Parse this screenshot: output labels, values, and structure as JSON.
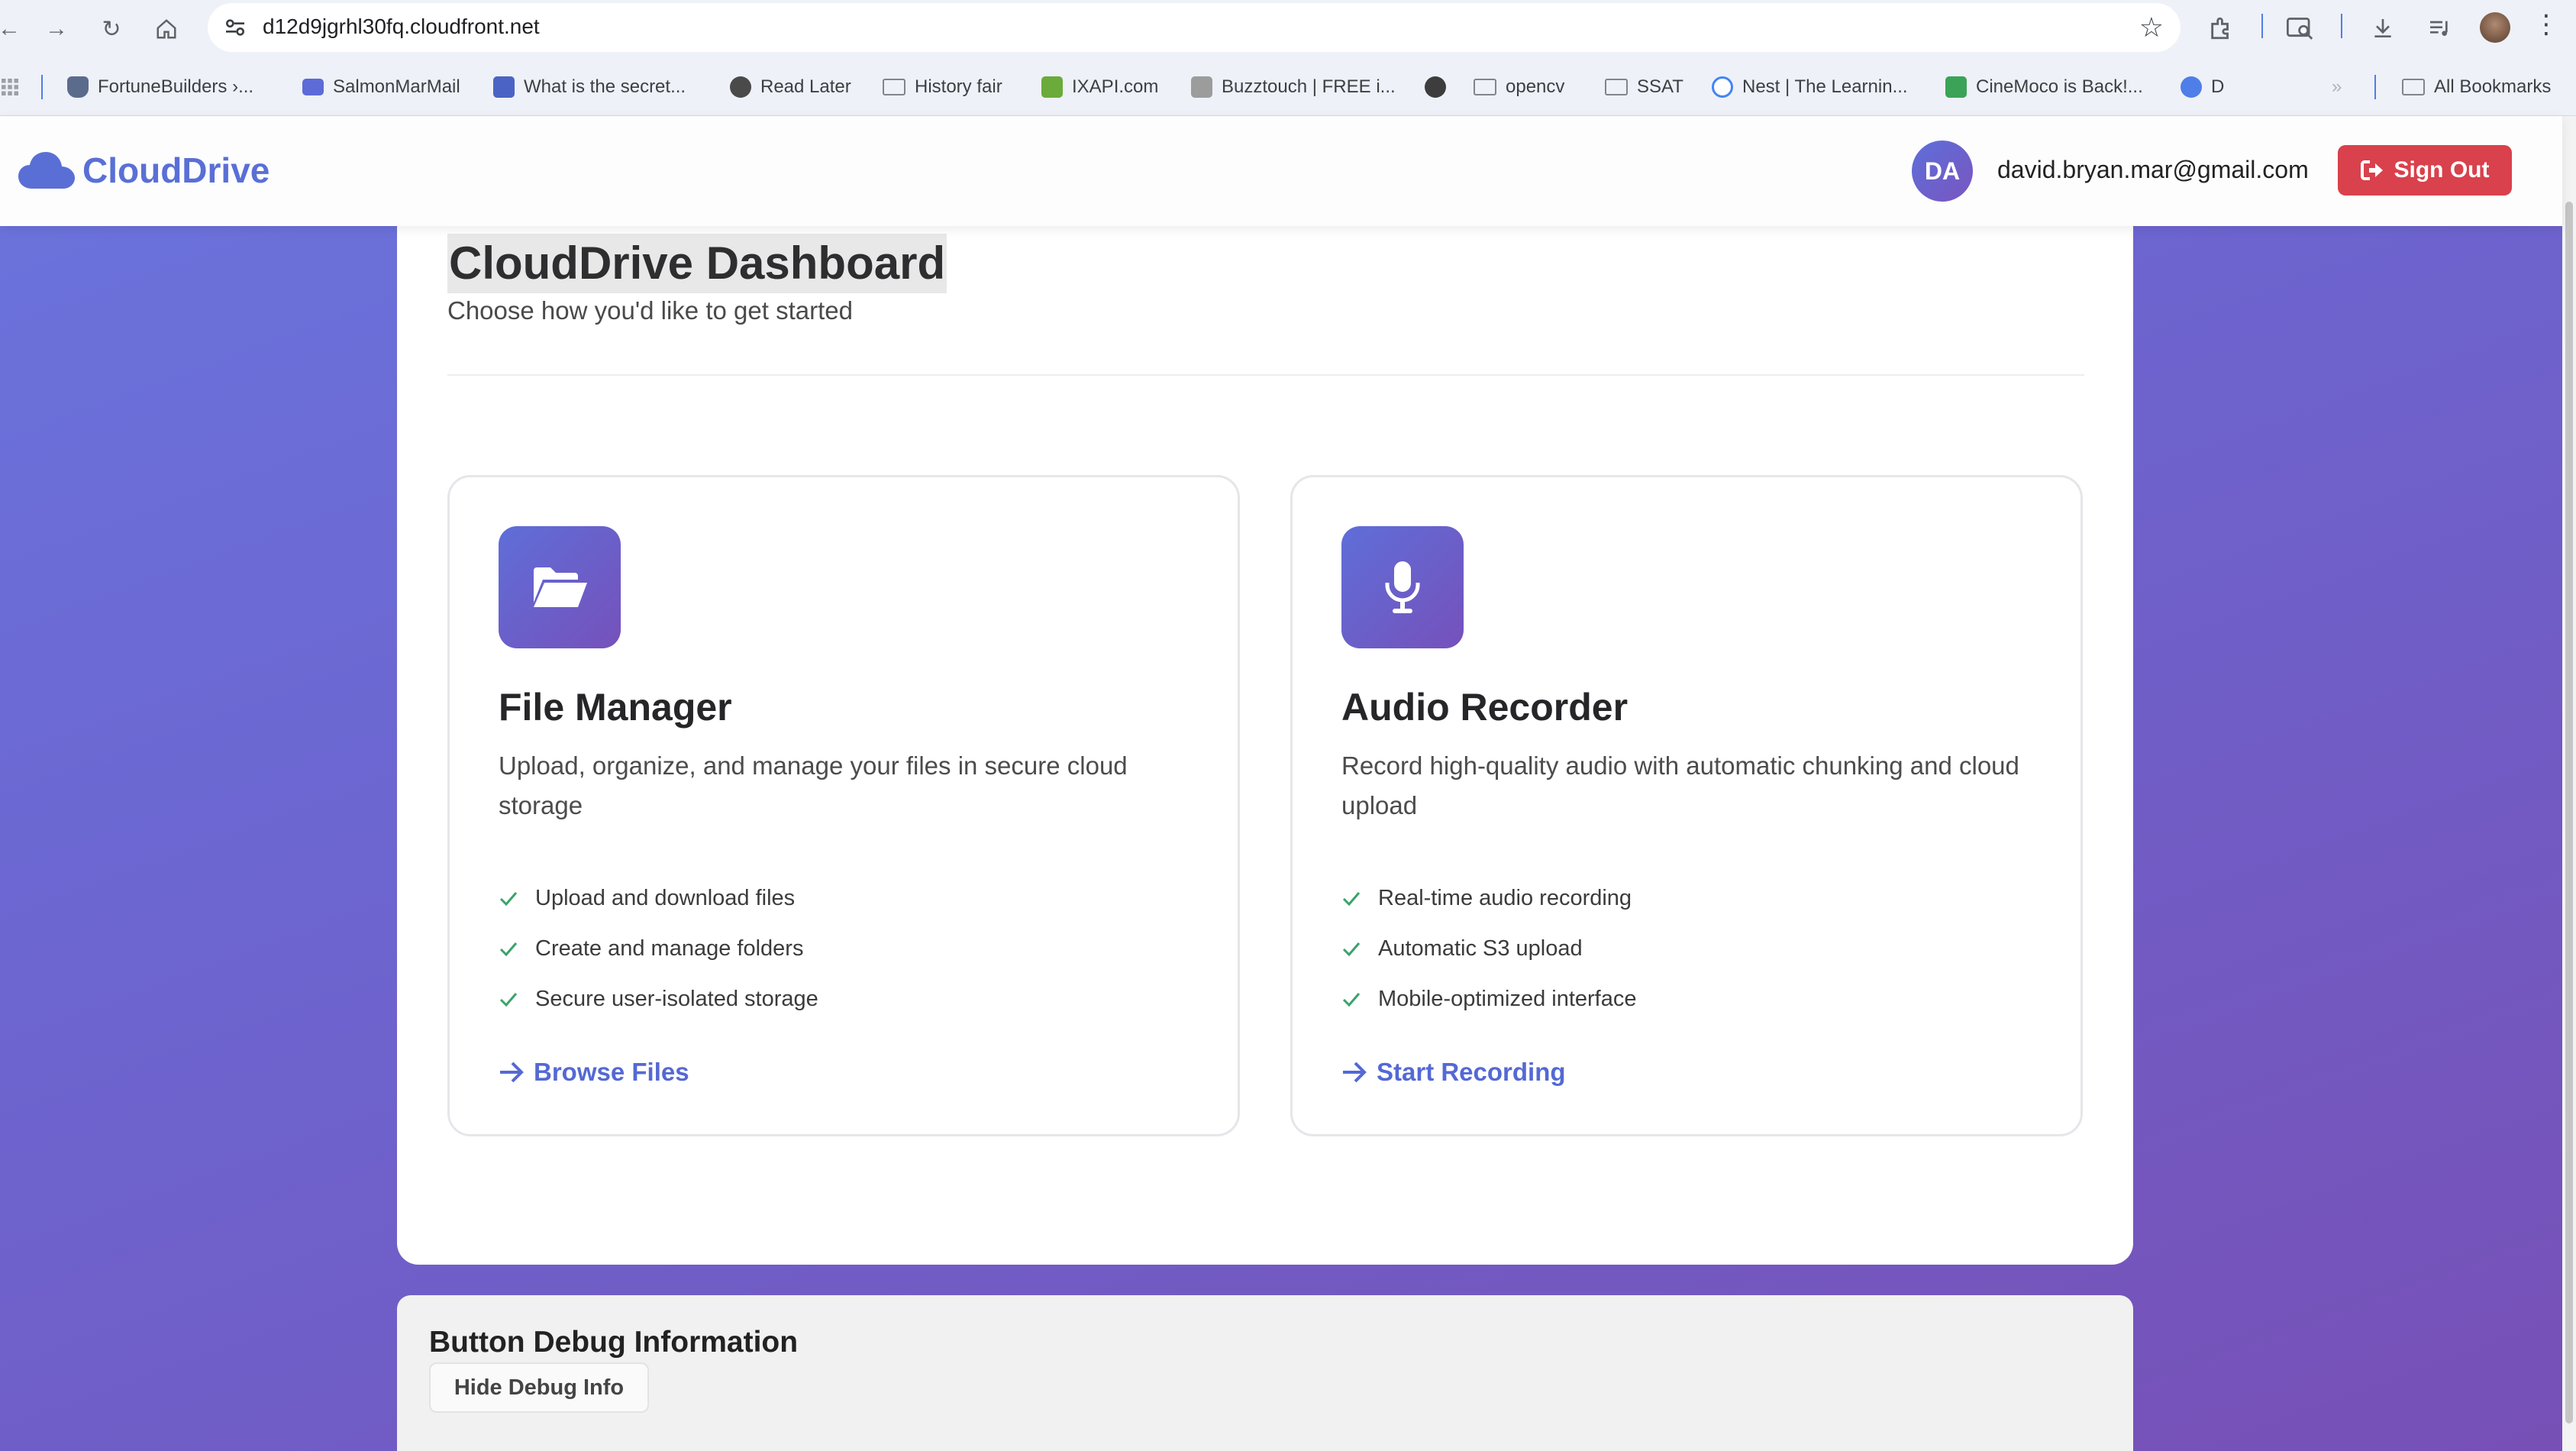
{
  "browser": {
    "url": "d12d9jgrhl30fq.cloudfront.net",
    "bookmarks": [
      {
        "label": "FortuneBuilders ›...",
        "color": "#5b6b8c"
      },
      {
        "label": "SalmonMarMail",
        "color": "#5c6bd8"
      },
      {
        "label": "What is the secret...",
        "color": "#4b63c4"
      },
      {
        "label": "Read Later",
        "color": "#4a4a4a"
      },
      {
        "label": "History fair",
        "color": ""
      },
      {
        "label": "IXAPI.com",
        "color": "#6aab3c"
      },
      {
        "label": "Buzztouch | FREE i...",
        "color": "#9c9c9c"
      },
      {
        "label": "",
        "color": "#3d3d3d"
      },
      {
        "label": "opencv",
        "color": ""
      },
      {
        "label": "SSAT",
        "color": ""
      },
      {
        "label": "Nest | The Learnin...",
        "color": "#4285f4"
      },
      {
        "label": "CineMoco is Back!...",
        "color": "#3aa357"
      },
      {
        "label": "D",
        "color": "#4f7ee8"
      }
    ],
    "all_bookmarks_label": "All Bookmarks"
  },
  "header": {
    "brand": "CloudDrive",
    "avatar_initials": "DA",
    "email": "david.bryan.mar@gmail.com",
    "sign_out_label": "Sign Out"
  },
  "dashboard": {
    "title": "CloudDrive Dashboard",
    "subtitle": "Choose how you'd like to get started"
  },
  "cards": [
    {
      "icon": "folder-open-icon",
      "title": "File Manager",
      "description": "Upload, organize, and manage your files in secure cloud storage",
      "features": [
        "Upload and download files",
        "Create and manage folders",
        "Secure user-isolated storage"
      ],
      "cta": "Browse Files"
    },
    {
      "icon": "microphone-icon",
      "title": "Audio Recorder",
      "description": "Record high-quality audio with automatic chunking and cloud upload",
      "features": [
        "Real-time audio recording",
        "Automatic S3 upload",
        "Mobile-optimized interface"
      ],
      "cta": "Start Recording"
    }
  ],
  "debug": {
    "title": "Button Debug Information",
    "toggle_label": "Hide Debug Info"
  },
  "colors": {
    "brand": "#5a6fd6",
    "accent_gradient": [
      "#5f6ed8",
      "#7651bb"
    ],
    "sign_out": "#d9414c",
    "check": "#3aa36a",
    "link": "#5469d4"
  }
}
